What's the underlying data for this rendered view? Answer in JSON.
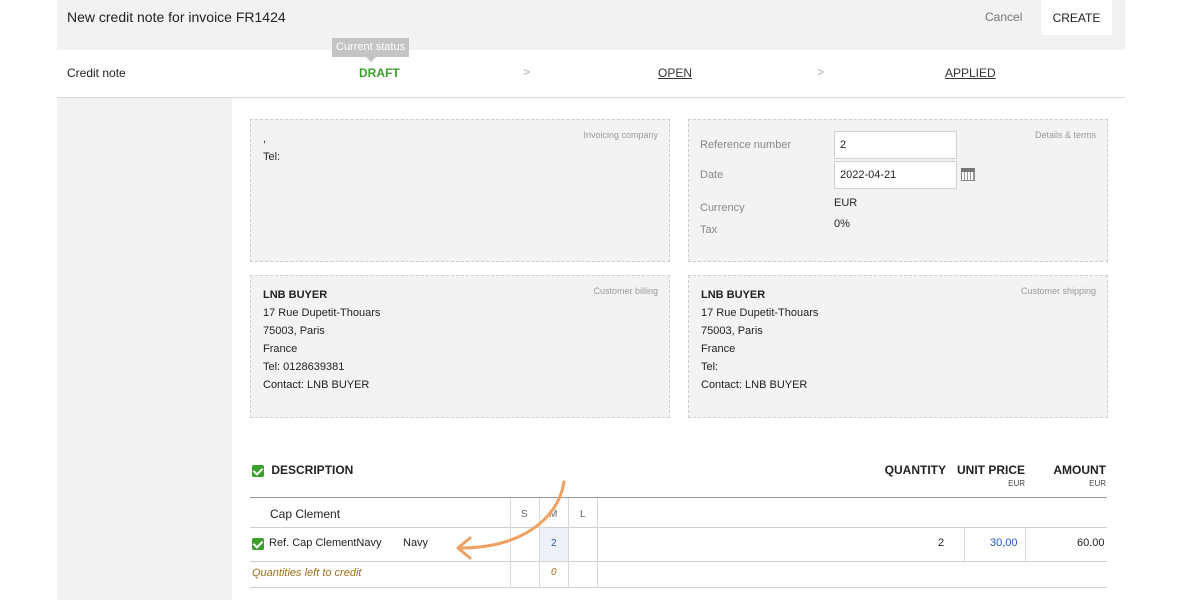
{
  "header": {
    "title": "New credit note for invoice FR1424",
    "cancel_label": "Cancel",
    "create_label": "CREATE"
  },
  "status": {
    "doc_type": "Credit note",
    "tooltip": "Current status",
    "steps": [
      "DRAFT",
      "OPEN",
      "APPLIED"
    ],
    "current": "DRAFT",
    "chevron": ">"
  },
  "invoicing_company": {
    "tag": "Invoicing company",
    "line1": ",",
    "line2": "Tel:"
  },
  "details": {
    "tag": "Details & terms",
    "reference_label": "Reference number",
    "reference_value": "2",
    "date_label": "Date",
    "date_value": "2022-04-21",
    "currency_label": "Currency",
    "currency_value": "EUR",
    "tax_label": "Tax",
    "tax_value": "0%"
  },
  "customer_billing": {
    "tag": "Customer billing",
    "name": "LNB BUYER",
    "street": "17 Rue Dupetit-Thouars",
    "city": "75003, Paris",
    "country": "France",
    "tel": "Tel: 0128639381",
    "contact": "Contact: LNB BUYER"
  },
  "customer_shipping": {
    "tag": "Customer shipping",
    "name": "LNB BUYER",
    "street": "17 Rue Dupetit-Thouars",
    "city": "75003, Paris",
    "country": "France",
    "tel": "Tel:",
    "contact": "Contact: LNB BUYER"
  },
  "table": {
    "description_header": "DESCRIPTION",
    "quantity_header": "QUANTITY",
    "unit_price_header": "UNIT PRICE",
    "unit_price_currency": "EUR",
    "amount_header": "AMOUNT",
    "amount_currency": "EUR",
    "product_name": "Cap Clement",
    "sizes": [
      "S",
      "M",
      "L"
    ],
    "line_ref": "Ref. Cap ClementNavy",
    "line_color": "Navy",
    "line_size_qty": "2",
    "line_quantity": "2",
    "line_unit_price": "30,00",
    "line_amount": "60.00",
    "left_to_credit_label": "Quantities left to credit",
    "left_to_credit_value": "0"
  },
  "colors": {
    "accent_green": "#3aa02c",
    "link_blue": "#2255cc",
    "annotation_orange": "#f0a060",
    "italic_gold": "#a07020"
  }
}
